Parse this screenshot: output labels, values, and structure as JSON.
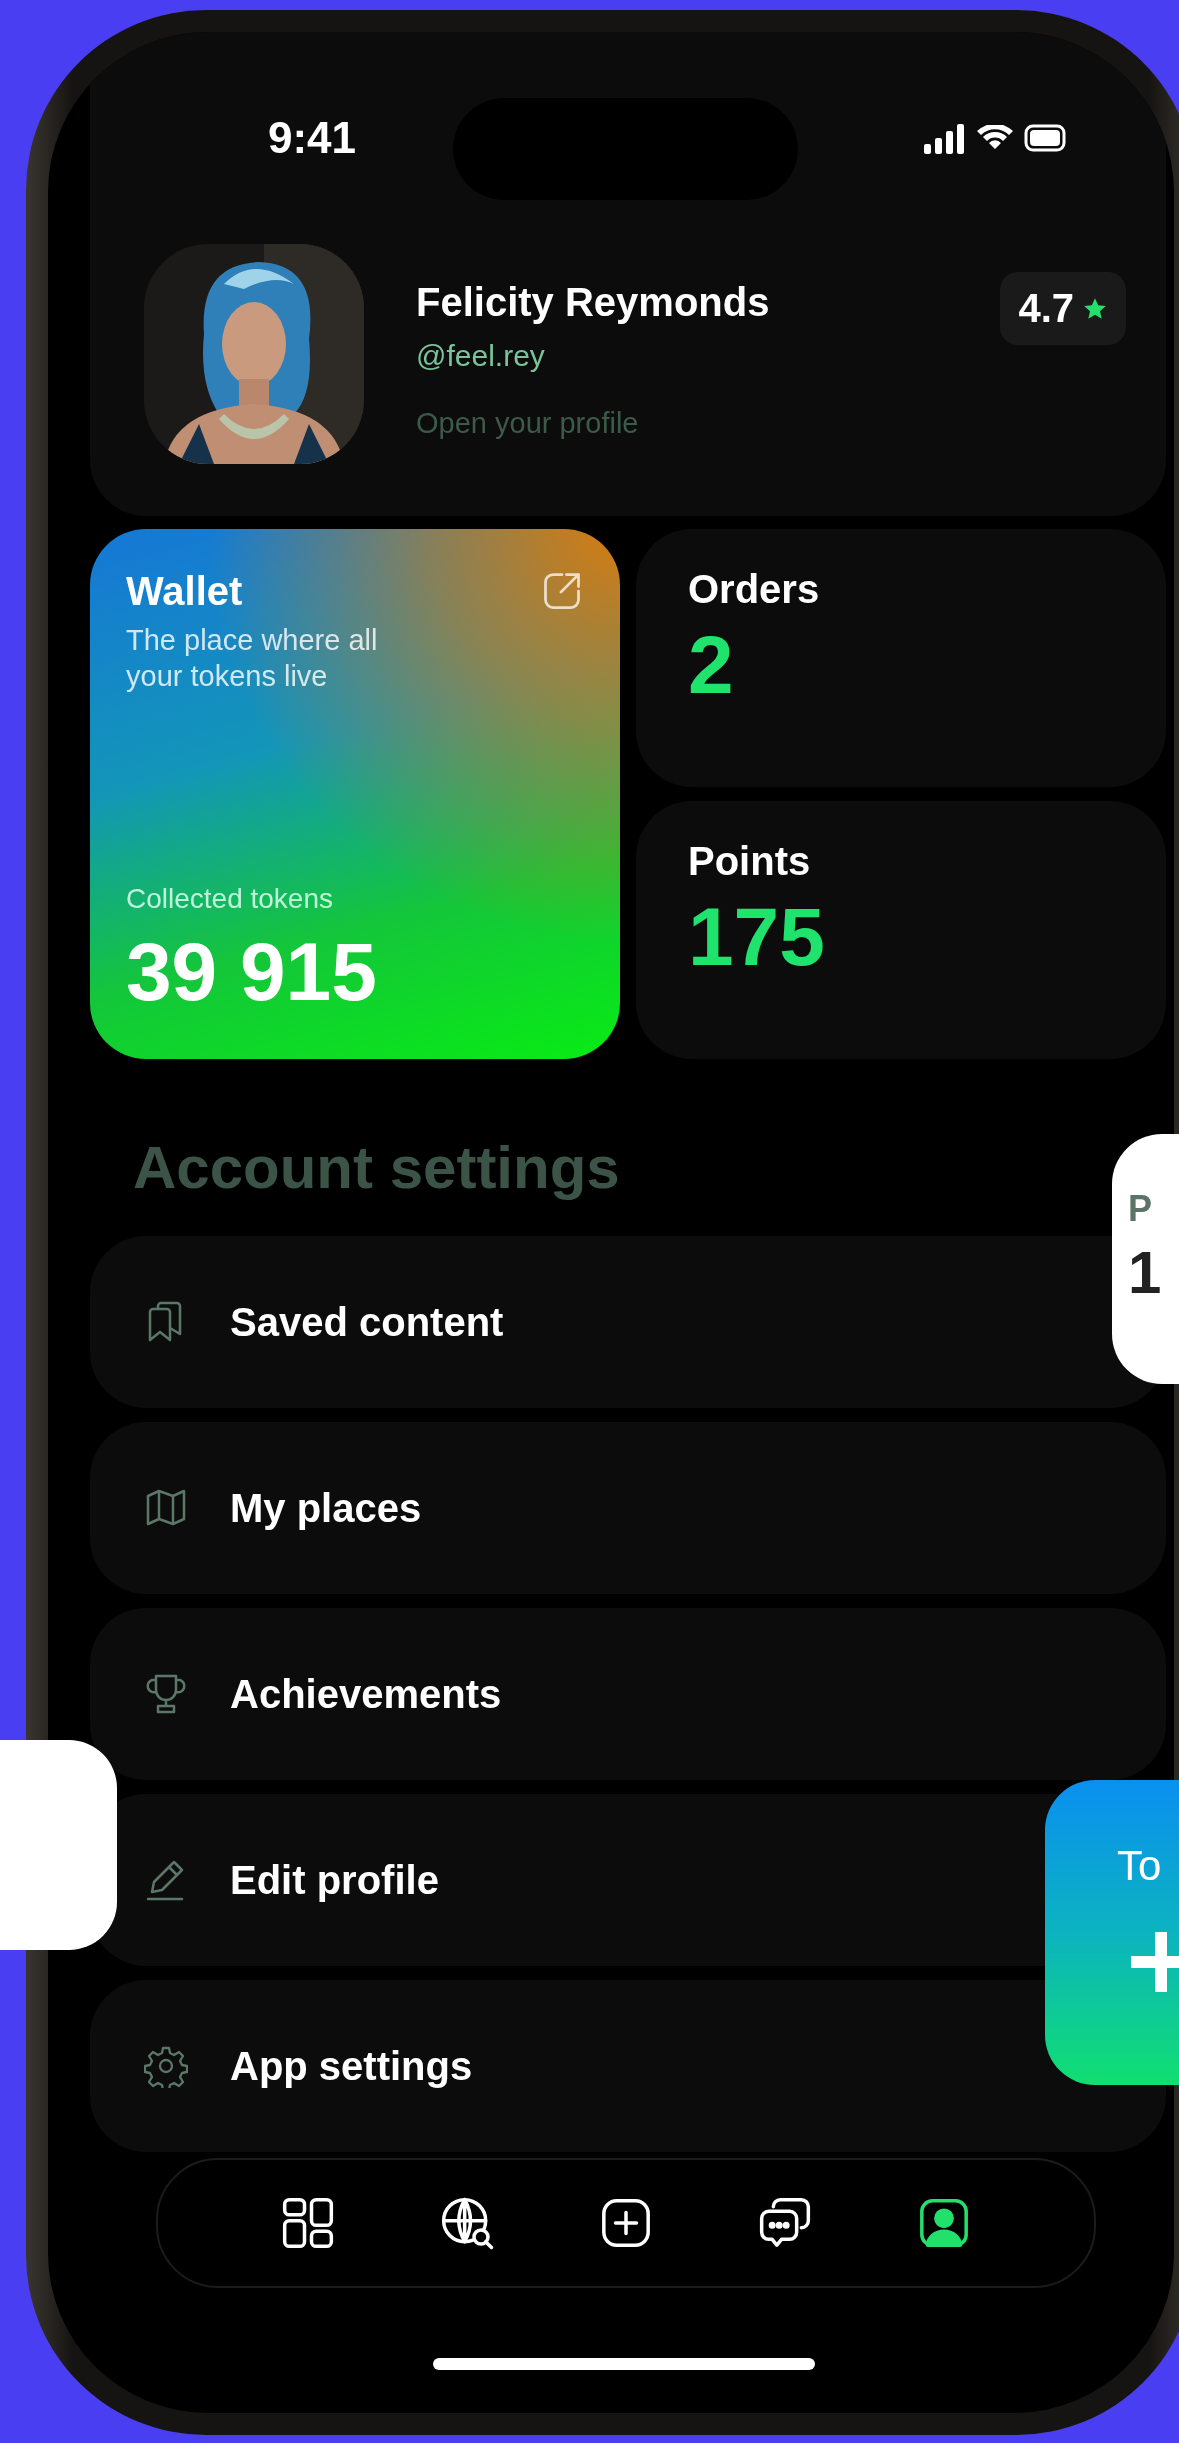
{
  "status_bar": {
    "time": "9:41"
  },
  "profile": {
    "name": "Felicity Reymonds",
    "handle": "@feel.rey",
    "link": "Open your profile",
    "rating": "4.7"
  },
  "wallet": {
    "title": "Wallet",
    "subtitle": "The place where all your tokens live",
    "label": "Collected tokens",
    "value": "39 915"
  },
  "tiles": [
    {
      "title": "Orders",
      "value": "2"
    },
    {
      "title": "Points",
      "value": "175"
    }
  ],
  "settings": {
    "title": "Account settings",
    "items": [
      {
        "kind": "saved",
        "label": "Saved content"
      },
      {
        "kind": "places",
        "label": "My places"
      },
      {
        "kind": "achievements",
        "label": "Achievements"
      },
      {
        "kind": "edit",
        "label": "Edit profile"
      },
      {
        "kind": "settings",
        "label": "App settings"
      }
    ]
  },
  "tab_bar": [
    {
      "kind": "dashboard",
      "selected": false
    },
    {
      "kind": "explore",
      "selected": false
    },
    {
      "kind": "add",
      "selected": false
    },
    {
      "kind": "chat",
      "selected": false
    },
    {
      "kind": "profile",
      "selected": true
    }
  ],
  "floating_cards": [
    {
      "kind": "light",
      "title": "P",
      "value": "1"
    },
    {
      "kind": "blank"
    },
    {
      "kind": "gradient",
      "title": "To"
    }
  ]
}
